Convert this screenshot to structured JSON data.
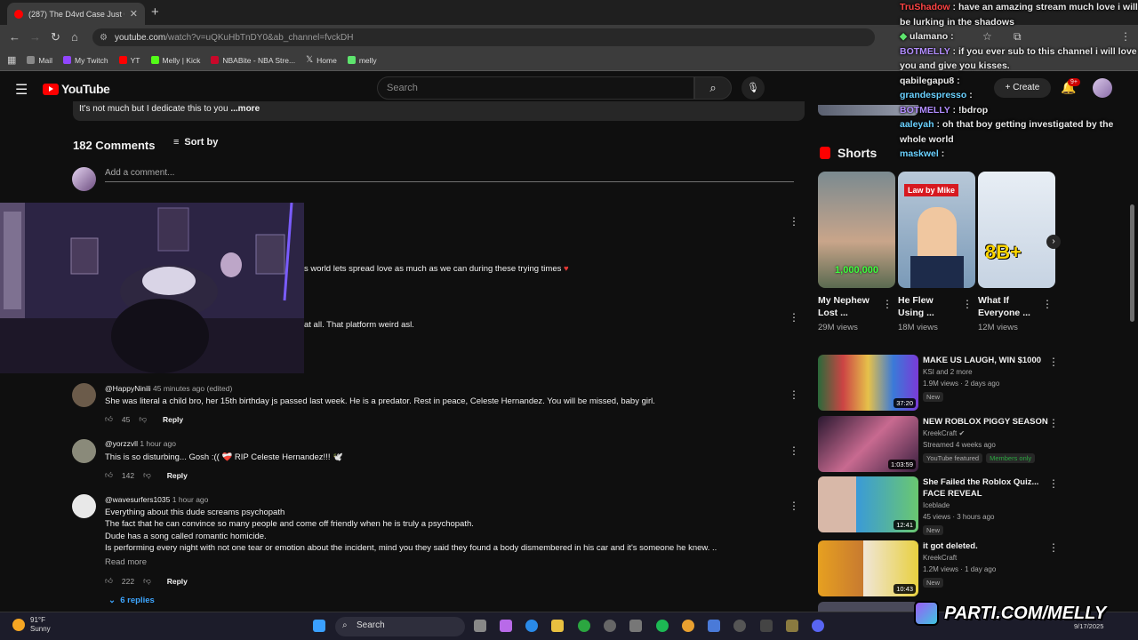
{
  "browser": {
    "tab_title": "(287) The D4vd Case Just G...",
    "url_main": "youtube.com",
    "url_rest": "/watch?v=uQKuHbTnDY0&ab_channel=fvckDH",
    "bookmarks": [
      "Mail",
      "My Twitch",
      "YT",
      "Melly | Kick",
      "NBABite - NBA Stre...",
      "Home",
      "melly"
    ]
  },
  "youtube": {
    "logo": "YouTube",
    "search_placeholder": "Search",
    "create_label": "Create",
    "notif_badge": "9+"
  },
  "description": {
    "text": "It's not much but I dedicate this to you",
    "more": " ...more"
  },
  "comments": {
    "count_label": "182 Comments",
    "sort_label": "Sort by",
    "add_placeholder": "Add a comment...",
    "partial1": "s world lets spread love as much as we can during these trying times",
    "partial2": "at all. That platform weird asl.",
    "items": [
      {
        "user": "@HappyNinili",
        "time": "45 minutes ago (edited)",
        "text": "She was literal a child bro, her 15th birthday js passed last week. He is a predator. Rest in peace, Celeste Hernandez. You will be missed, baby girl.",
        "likes": "45",
        "reply": "Reply"
      },
      {
        "user": "@yorzzvll",
        "time": "1 hour ago",
        "text": "This is so disturbing... Gosh :(( ❤️‍🩹 RIP Celeste Hernandez!!! 🕊️",
        "likes": "142",
        "reply": "Reply"
      },
      {
        "user": "@wavesurfers1035",
        "time": "1 hour ago",
        "lines": [
          "Everything about this dude screams psychopath",
          "The fact that he can convince so many people and come off friendly when he is truly a psychopath.",
          "Dude has a song called romantic homicide.",
          "Is performing every night with not one tear or emotion about the incident, mind you they said they found a body dismembered in his car and it's someone he knew. .."
        ],
        "read_more": "Read more",
        "likes": "222",
        "reply": "Reply",
        "replies": "6 replies"
      }
    ]
  },
  "shorts": {
    "title": "Shorts",
    "items": [
      {
        "title": "My Nephew Lost ...",
        "views": "29M views",
        "overlay": "1,000,000"
      },
      {
        "title": "He Flew Using ...",
        "views": "18M views",
        "overlay": "Law by Mike"
      },
      {
        "title": "What If Everyone ...",
        "views": "12M views",
        "overlay": "8B+"
      }
    ]
  },
  "recommended": [
    {
      "title": "MAKE US LAUGH, WIN $1000",
      "channel": "KSI and 2 more",
      "meta": "1.9M views · 2 days ago",
      "tags": [
        "New"
      ],
      "duration": "37:20"
    },
    {
      "title": "NEW ROBLOX PIGGY SEASON",
      "channel": "KreekCraft",
      "meta": "Streamed 4 weeks ago",
      "tags": [
        "YouTube featured",
        "Members only"
      ],
      "duration": "1:03:59"
    },
    {
      "title": "She Failed the Roblox Quiz... FACE REVEAL",
      "channel": "Iceblade",
      "meta": "45 views · 3 hours ago",
      "tags": [
        "New"
      ],
      "duration": "12:41"
    },
    {
      "title": "it got deleted.",
      "channel": "KreekCraft",
      "meta": "1.2M views · 1 day ago",
      "tags": [
        "New"
      ],
      "duration": "10:43"
    }
  ],
  "chat": [
    {
      "user": "TruShadow",
      "msg": "have an amazing stream much love i will be lurking in the shadows"
    },
    {
      "user": "ulamano",
      "msg": ""
    },
    {
      "user": "BOTMELLY",
      "msg": "if you ever sub to this channel i will love you and give you kisses."
    },
    {
      "user": "qabilegapu8",
      "msg": ""
    },
    {
      "user": "grandespresso",
      "msg": ""
    },
    {
      "user": "BOTMELLY",
      "msg": "!bdrop"
    },
    {
      "user": "aaleyah",
      "msg": "oh that boy getting investigated by the whole world"
    },
    {
      "user": "maskwel",
      "msg": ""
    }
  ],
  "taskbar": {
    "temp": "91°F",
    "weather": "Sunny",
    "search": "Search",
    "date": "9/17/2025"
  },
  "overlay": {
    "brand": "PARTI.COM/MELLY"
  }
}
